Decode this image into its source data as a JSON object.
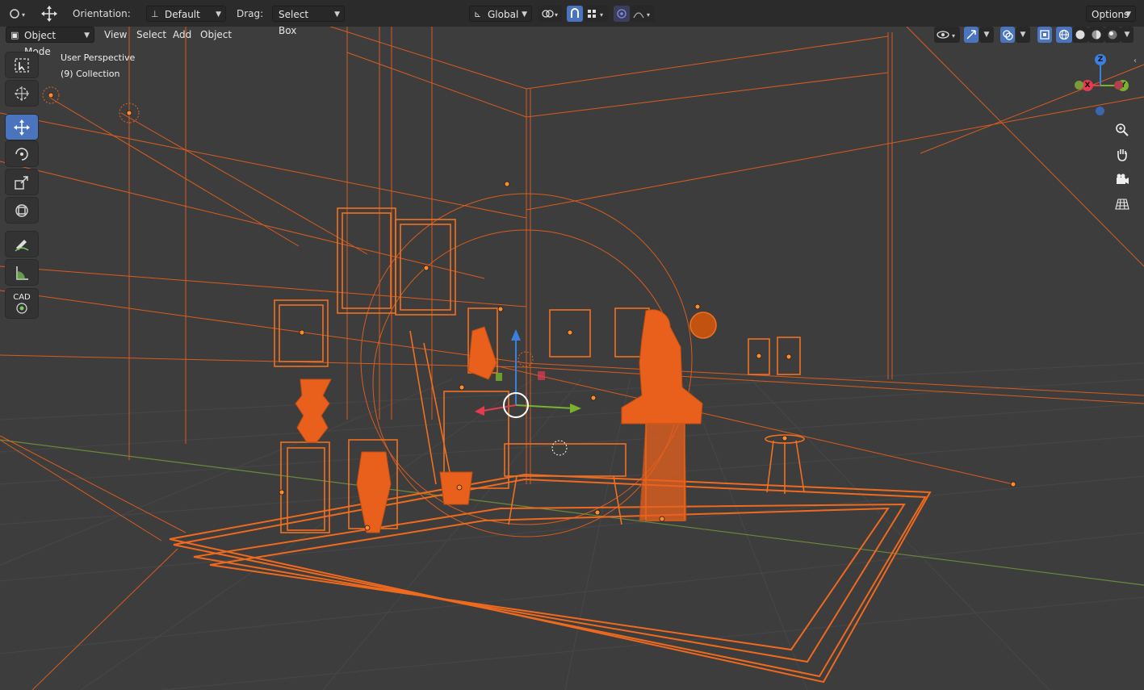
{
  "toolbar": {
    "orientation_label": "Orientation:",
    "orientation_value": "Default",
    "drag_label": "Drag:",
    "drag_value": "Select Box",
    "transform_orientation": "Global",
    "options_label": "Options"
  },
  "header": {
    "mode": "Object Mode",
    "menus": [
      "View",
      "Select",
      "Add",
      "Object"
    ]
  },
  "viewport": {
    "view_name": "User Perspective",
    "collection": "(9) Collection",
    "gizmo": {
      "x": "X",
      "y": "Y",
      "z": "Z"
    },
    "selection_color": "#e8601c",
    "tools_icons": [
      "select-box-icon",
      "cursor-icon",
      "move-icon",
      "rotate-icon",
      "scale-icon",
      "transform-icon",
      "annotate-icon",
      "measure-icon",
      "cad-icon"
    ],
    "cad_label": "CAD"
  },
  "colors": {
    "accent": "#4b74be",
    "wire": "#e8601c",
    "axis_x": "#e53a4f",
    "axis_y": "#79b32c",
    "axis_z": "#3d7fde"
  }
}
